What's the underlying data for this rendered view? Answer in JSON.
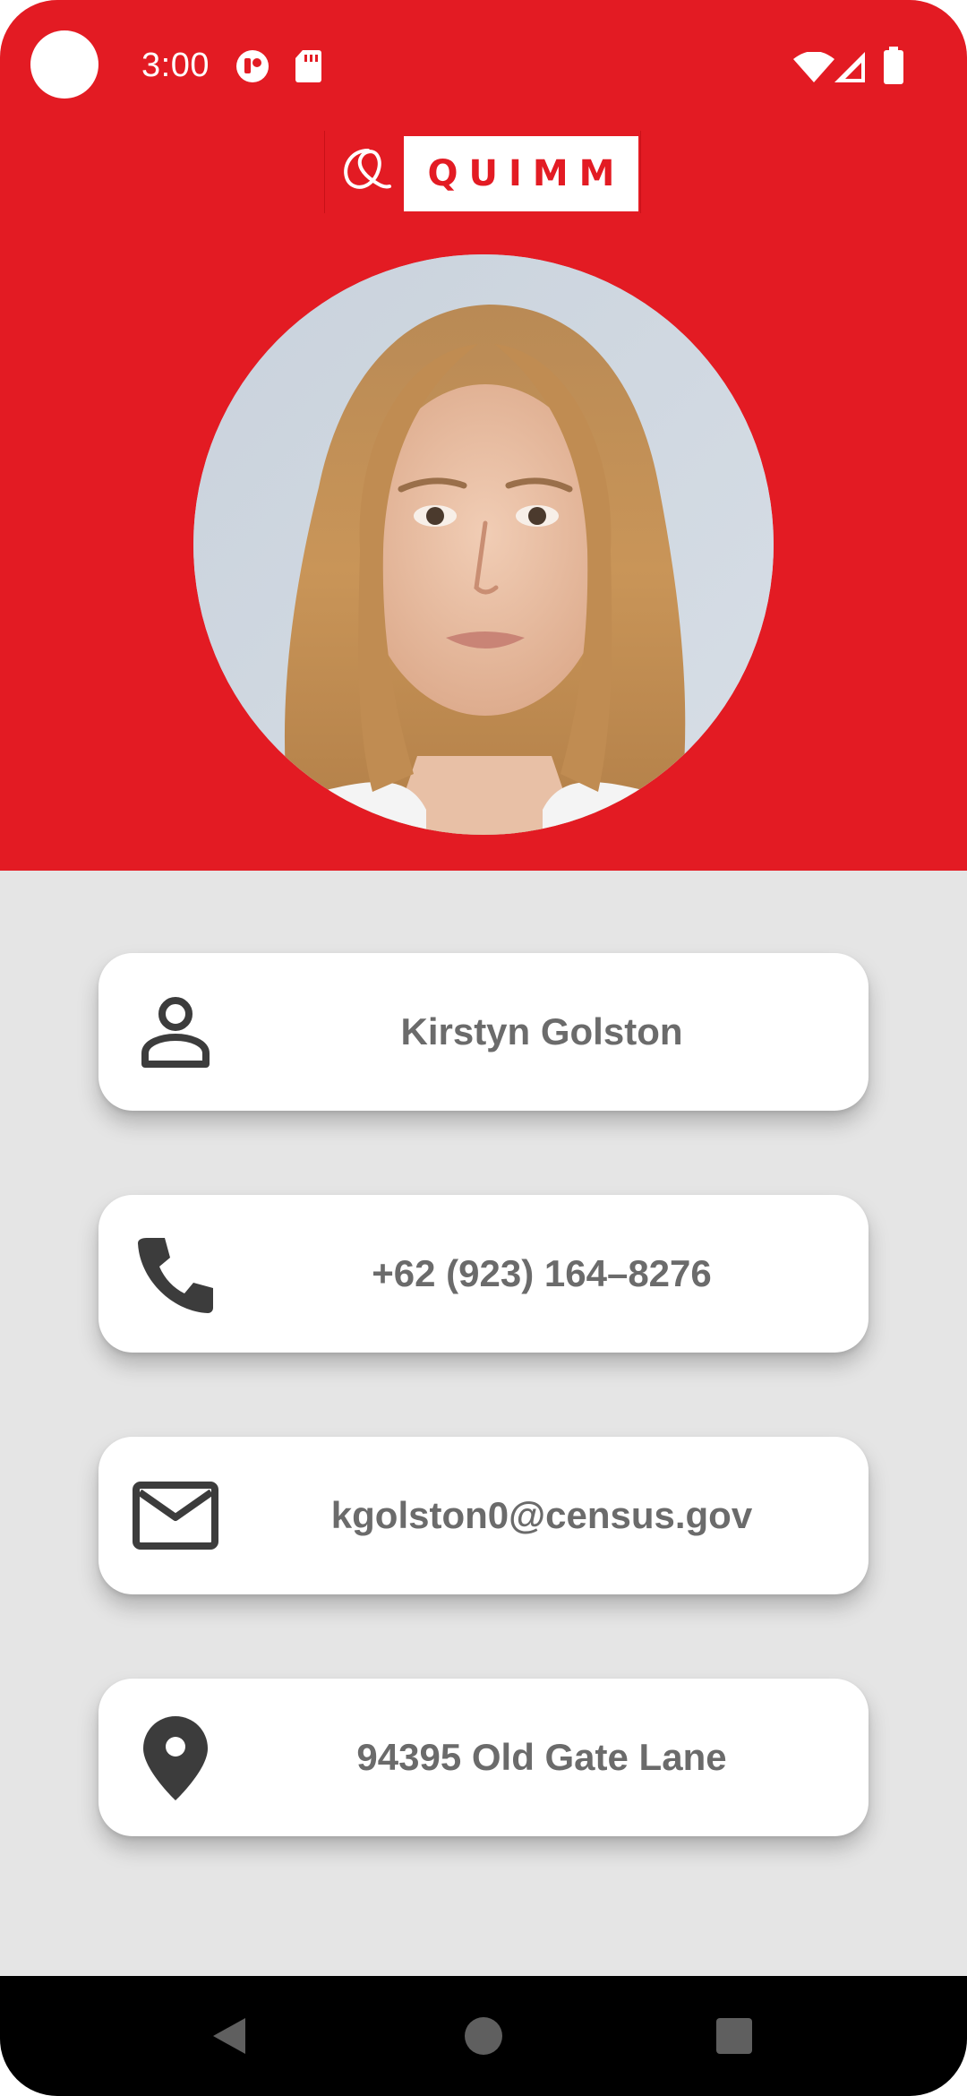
{
  "status_bar": {
    "time": "3:00",
    "icons": [
      "camera-cutout-icon",
      "app-notification-icon",
      "sd-card-icon",
      "wifi-icon",
      "cellular-signal-icon",
      "battery-icon"
    ],
    "background_color": "#e31b23"
  },
  "header": {
    "logo_text": "QUIMM",
    "logo_mark_icon": "script-q-logo-icon",
    "background_color": "#e31b23"
  },
  "profile": {
    "avatar": "profile-photo-icon",
    "name": "Kirstyn Golston",
    "phone": "+62 (923) 164–8276",
    "email": "kgolston0@census.gov",
    "address": "94395 Old Gate Lane"
  },
  "cards": [
    {
      "icon": "person-icon",
      "field": "name"
    },
    {
      "icon": "phone-icon",
      "field": "phone"
    },
    {
      "icon": "mail-icon",
      "field": "email"
    },
    {
      "icon": "location-pin-icon",
      "field": "address"
    }
  ],
  "nav_bar": {
    "icons": [
      "back-icon",
      "home-icon",
      "recents-icon"
    ]
  },
  "colors": {
    "accent": "#e31b23",
    "card_text": "#6b6b6b",
    "icon": "#3c3c3c",
    "page_background": "#e5e5e5"
  }
}
